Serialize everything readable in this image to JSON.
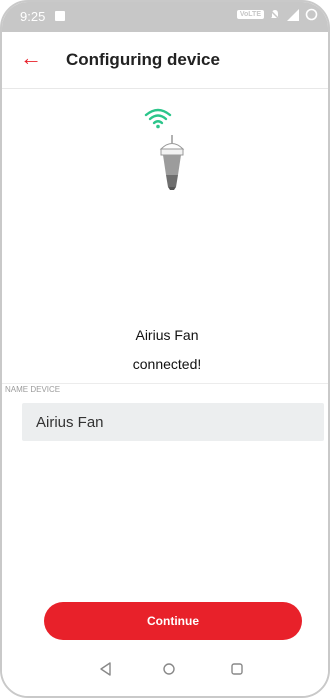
{
  "status_bar": {
    "time": "9:25",
    "image_icon": "image-icon",
    "volte_badge": "VoLTE",
    "icons": [
      "volte-icon",
      "mute-icon",
      "signal-icon",
      "battery-ring-icon"
    ]
  },
  "header": {
    "back_icon": "arrow-left-icon",
    "title": "Configuring device"
  },
  "device": {
    "wifi_icon": "wifi-icon",
    "device_icon": "fan-device-icon",
    "name": "Airius Fan",
    "status": "connected!"
  },
  "form": {
    "label": "NAME DEVICE",
    "value": "Airius Fan"
  },
  "actions": {
    "continue_label": "Continue"
  },
  "nav_bar": {
    "icons": [
      "triangle-back-icon",
      "circle-home-icon",
      "square-recents-icon"
    ]
  },
  "colors": {
    "accent": "#e8212a",
    "wifi": "#2bc58a",
    "status_bar": "#c7c7c7",
    "input_bg": "#eceeef"
  }
}
